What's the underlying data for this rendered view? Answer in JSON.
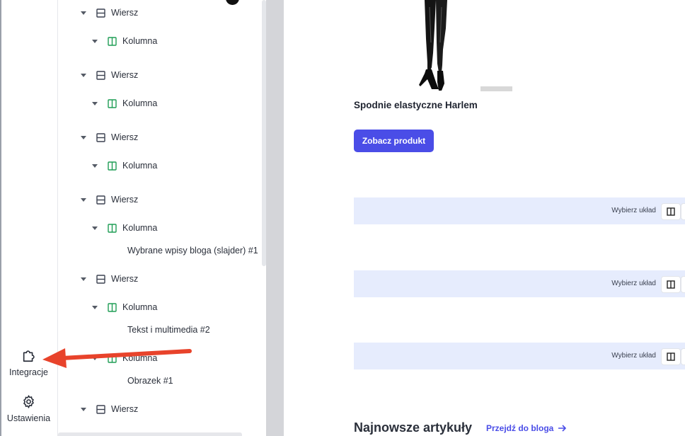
{
  "rail": {
    "integrations_label": "Integracje",
    "settings_label": "Ustawienia"
  },
  "tree": {
    "row_label": "Wiersz",
    "column_label": "Kolumna",
    "leaf_blog": "Wybrane wpisy bloga (slajder) #1",
    "leaf_text": "Tekst i multimedia #2",
    "leaf_image": "Obrazek #1"
  },
  "preview": {
    "product_name": "Spodnie elastyczne Harlem",
    "product_button": "Zobacz produkt",
    "layout_label": "Wybierz układ",
    "blog_title": "Najnowsze artykuły",
    "blog_link": "Przejdź do bloga"
  },
  "icons": {
    "rail_integrations": "puzzle-icon",
    "rail_settings": "gear-icon",
    "row": "row-icon",
    "column": "column-icon",
    "caret": "chevron-down-icon",
    "layout": "columns-layout-icon",
    "link_arrow": "arrow-right-icon",
    "annotation": "red-arrow-annotation"
  },
  "colors": {
    "accent": "#4a4de7",
    "column_icon": "#1f9d55",
    "band": "#e6ecfd",
    "annotation": "#e8432b"
  }
}
